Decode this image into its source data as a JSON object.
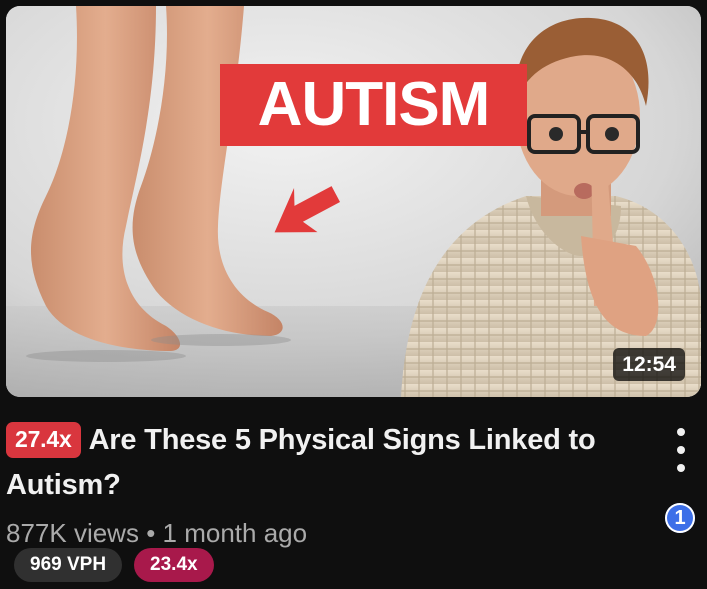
{
  "thumbnail": {
    "headline": "AUTISM",
    "duration": "12:54",
    "accent_color": "#e23a3a",
    "icons": [
      "arrow-icon"
    ]
  },
  "video": {
    "outlier_badge": "27.4x",
    "title": "Are These 5 Physical Signs Linked to Autism?",
    "views": "877K views",
    "separator": "•",
    "age": "1 month ago"
  },
  "chips": {
    "vph": "969 VPH",
    "multiplier": "23.4x"
  },
  "extension_badge": {
    "label": "1",
    "color": "#3d6fe8"
  },
  "menu": {
    "icon": "more-vert-icon"
  }
}
